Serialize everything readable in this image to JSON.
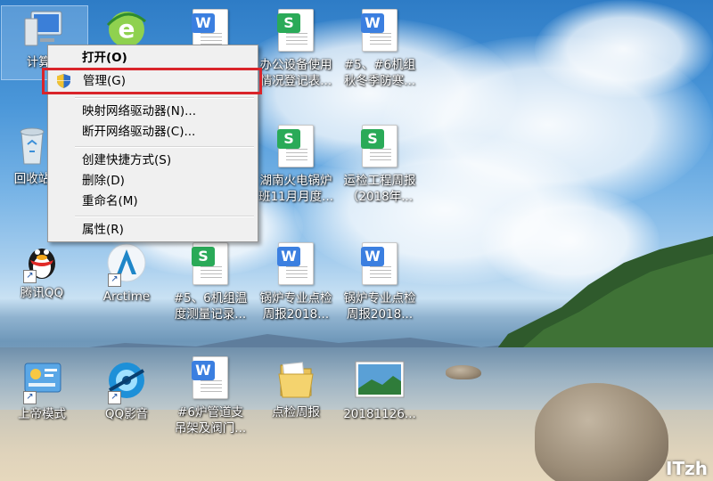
{
  "desktop": {
    "icons": [
      {
        "label": "计算机",
        "kind": "computer"
      },
      {
        "label": "",
        "kind": "ie"
      },
      {
        "label": "",
        "kind": "word"
      },
      {
        "label": "办公设备使用\n情况登记表...",
        "kind": "wps-s"
      },
      {
        "label": "#5、#6机组\n秋冬季防寒...",
        "kind": "word"
      },
      {
        "label": "回收站",
        "kind": "recycle-bin"
      },
      {
        "label": "湖南火电锅炉\n班11月月度...",
        "kind": "wps-s"
      },
      {
        "label": "运检工程周报\n（2018年...",
        "kind": "wps-s"
      },
      {
        "label": "腾讯QQ",
        "kind": "qq"
      },
      {
        "label": "Arctime",
        "kind": "arctime"
      },
      {
        "label": "#5、6机组温\n度测量记录...",
        "kind": "wps-s"
      },
      {
        "label": "锅炉专业点检\n周报2018...",
        "kind": "word"
      },
      {
        "label": "锅炉专业点检\n周报2018...",
        "kind": "word"
      },
      {
        "label": "上帝模式",
        "kind": "control-panel"
      },
      {
        "label": "QQ影音",
        "kind": "qqplayer"
      },
      {
        "label": "#6炉管道支\n吊架及阀门...",
        "kind": "word"
      },
      {
        "label": "点检周报",
        "kind": "folder"
      },
      {
        "label": "20181126...",
        "kind": "image"
      }
    ]
  },
  "menu": {
    "open": "打开(O)",
    "manage": "管理(G)",
    "map_drive": "映射网络驱动器(N)...",
    "disconnect_drive": "断开网络驱动器(C)...",
    "create_shortcut": "创建快捷方式(S)",
    "delete": "删除(D)",
    "rename": "重命名(M)",
    "properties": "属性(R)"
  },
  "badges": {
    "word": "W",
    "wps": "S"
  },
  "colors": {
    "highlight": "#d9242a",
    "word": "#3b7fe0",
    "wps": "#2aaa58"
  },
  "watermark": "ITzh"
}
